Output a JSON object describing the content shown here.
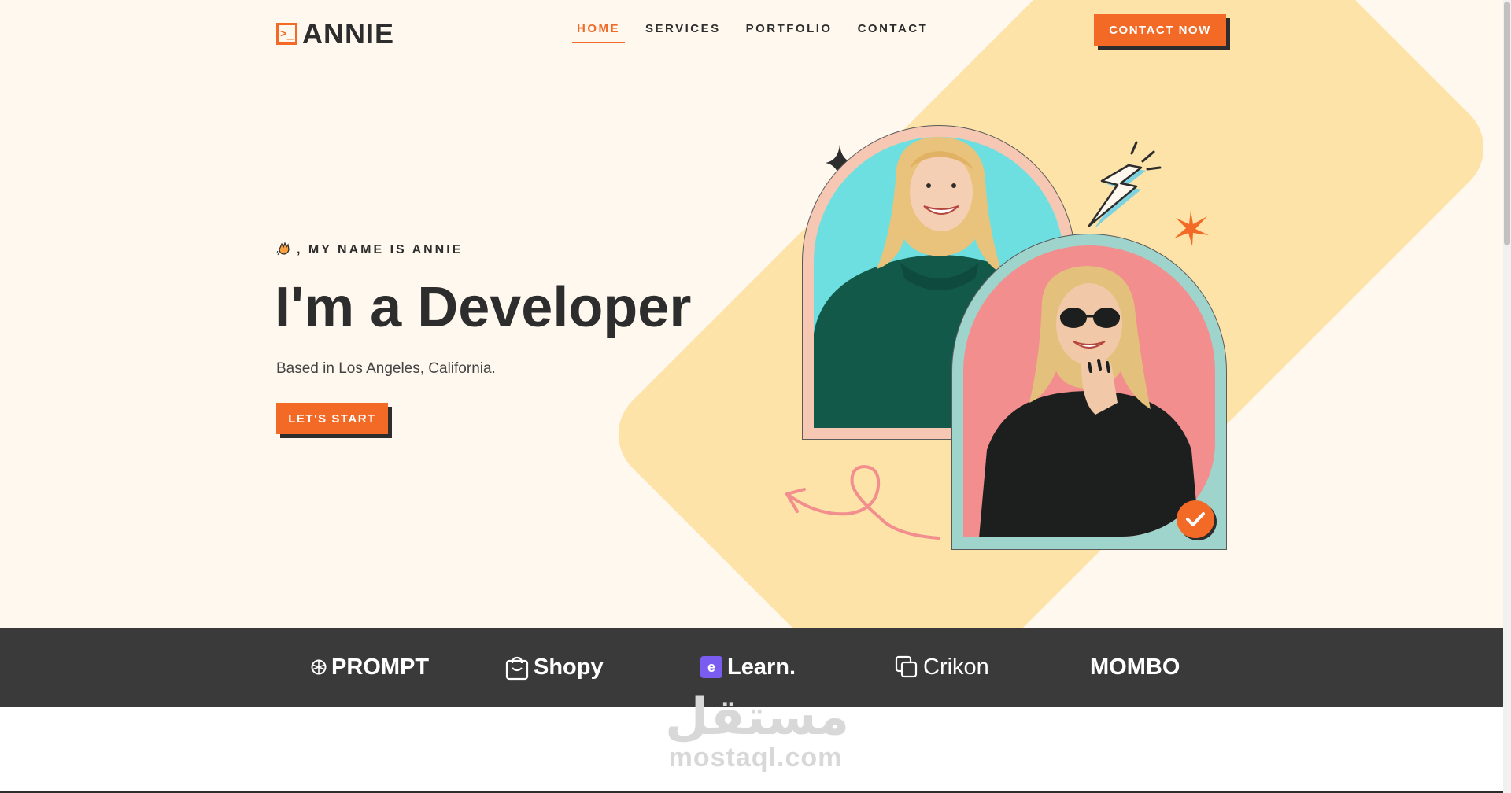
{
  "header": {
    "logo_mark": ">_",
    "logo_text": "ANNIE",
    "nav": [
      "HOME",
      "SERVICES",
      "PORTFOLIO",
      "CONTACT"
    ],
    "active_nav": "HOME",
    "contact_button": "CONTACT NOW"
  },
  "hero": {
    "greeting": ", MY NAME IS ANNIE",
    "greeting_icon": "waving-hand-icon",
    "headline": "I'm a Developer",
    "subtitle": "Based in Los Angeles, California.",
    "start_button": "LET'S START"
  },
  "brands": [
    {
      "name": "PROMPT",
      "icon": "prompt-icon"
    },
    {
      "name": "Shopy",
      "icon": "shopping-bag-icon"
    },
    {
      "name": "Learn.",
      "icon": "e-learn-icon"
    },
    {
      "name": "Crikon",
      "icon": "crikon-icon"
    },
    {
      "name": "MOMBO",
      "icon": "mombo-icon"
    }
  ],
  "watermark": {
    "arabic": "مستقل",
    "latin": "mostaql.com"
  },
  "colors": {
    "accent": "#f26a26",
    "dark": "#2d2d2d",
    "hero_bg": "#fff8ee",
    "band": "#fde3a8",
    "strip": "#3a3a3a",
    "photo1_bg": "#6ddfe0",
    "photo2_bg": "#f28e8e"
  }
}
